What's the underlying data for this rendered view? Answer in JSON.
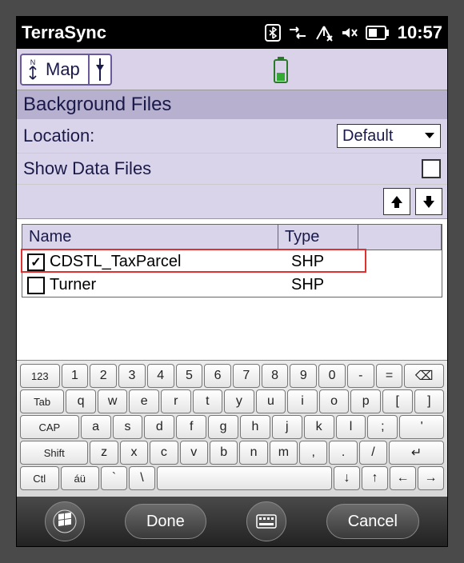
{
  "status": {
    "app_title": "TerraSync",
    "clock": "10:57"
  },
  "toolbar": {
    "map_label": "Map"
  },
  "section": {
    "title": "Background Files"
  },
  "location": {
    "label": "Location:",
    "value": "Default"
  },
  "show_data": {
    "label": "Show Data Files",
    "checked": false
  },
  "table": {
    "col_name": "Name",
    "col_type": "Type",
    "rows": [
      {
        "name": "CDSTL_TaxParcel",
        "type": "SHP",
        "checked": true
      },
      {
        "name": "Turner",
        "type": "SHP",
        "checked": false
      }
    ]
  },
  "keyboard": {
    "row0": [
      "123",
      "1",
      "2",
      "3",
      "4",
      "5",
      "6",
      "7",
      "8",
      "9",
      "0",
      "-",
      "=",
      "⌫"
    ],
    "row1": [
      "Tab",
      "q",
      "w",
      "e",
      "r",
      "t",
      "y",
      "u",
      "i",
      "o",
      "p",
      "[",
      "]"
    ],
    "row2": [
      "CAP",
      "a",
      "s",
      "d",
      "f",
      "g",
      "h",
      "j",
      "k",
      "l",
      ";",
      "'"
    ],
    "row3": [
      "Shift",
      "z",
      "x",
      "c",
      "v",
      "b",
      "n",
      "m",
      ",",
      ".",
      "/",
      "↵"
    ],
    "row4": [
      "Ctl",
      "áü",
      "`",
      "\\",
      "space",
      "↓",
      "↑",
      "←",
      "→"
    ]
  },
  "bottom": {
    "done": "Done",
    "cancel": "Cancel"
  }
}
